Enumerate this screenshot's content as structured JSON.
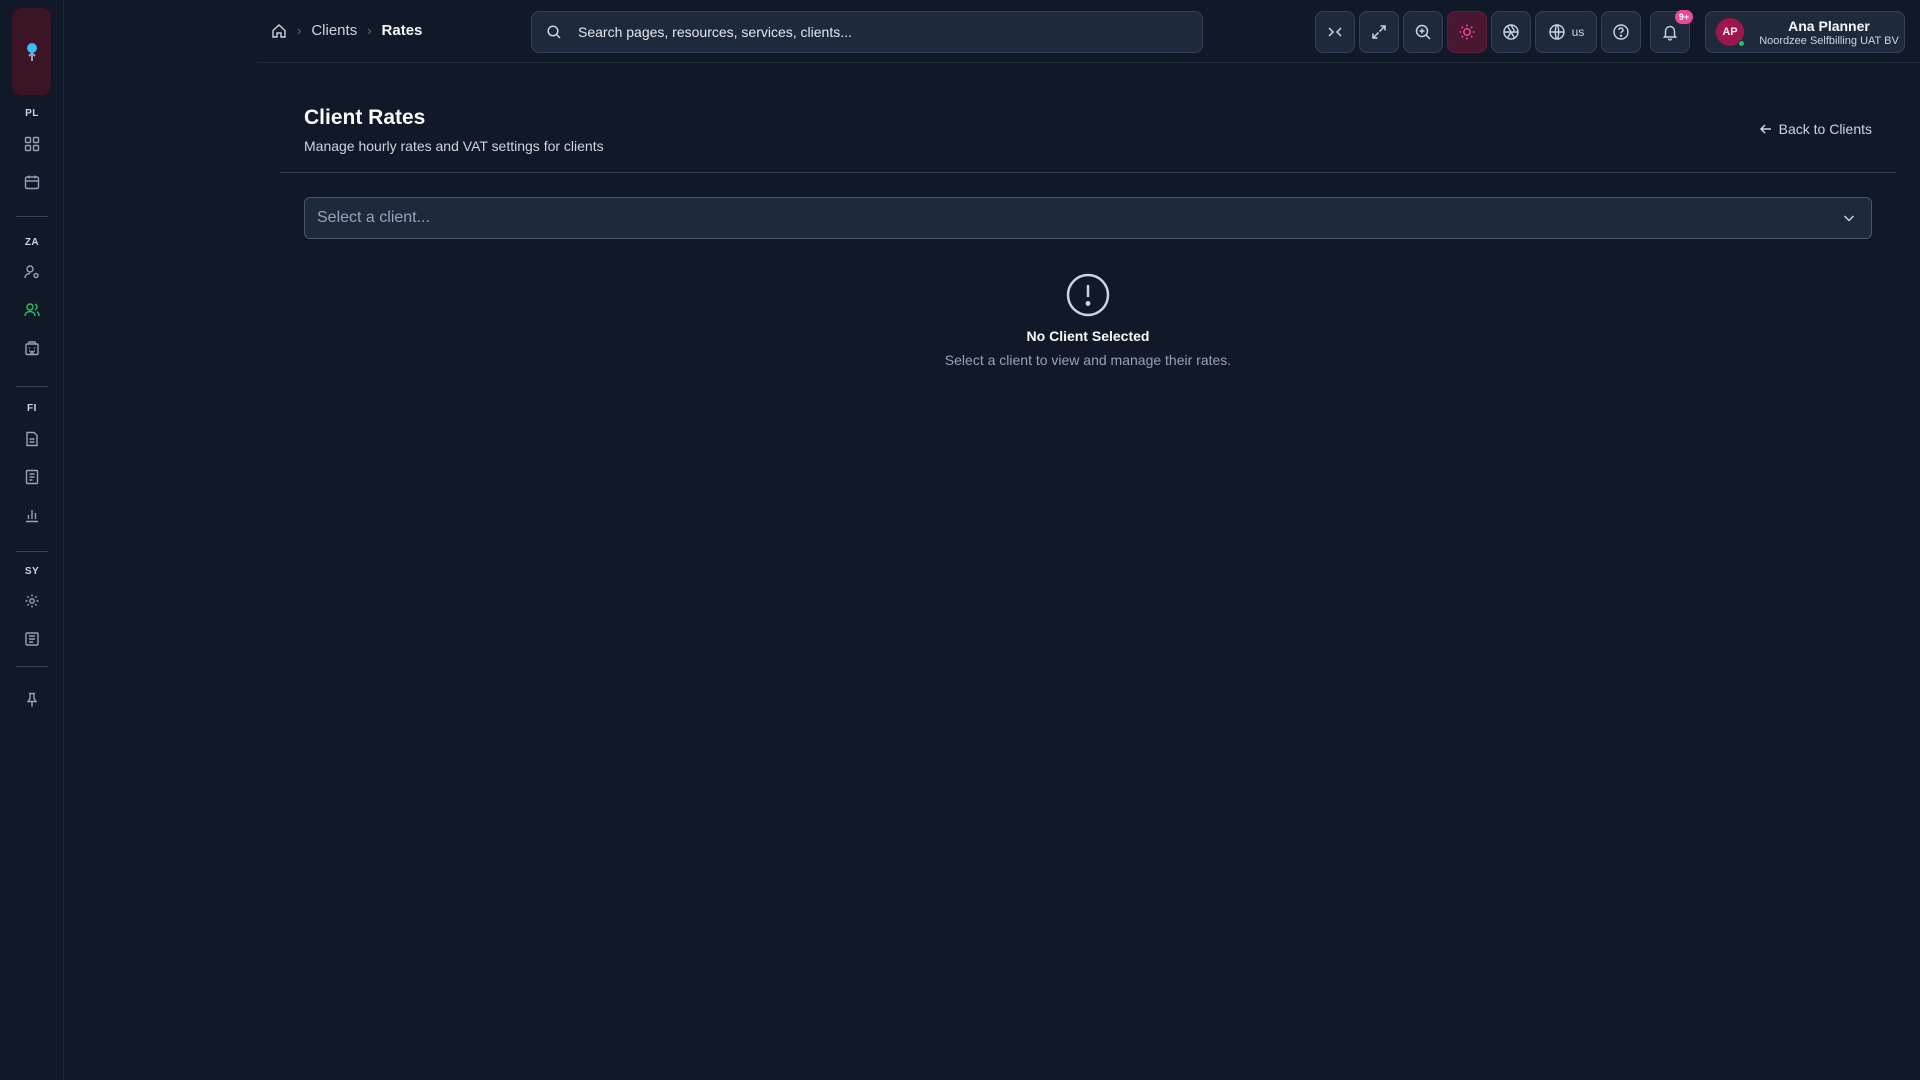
{
  "sidebar": {
    "sections": [
      {
        "label": "PL",
        "items": [
          "dashboard-icon",
          "calendar-icon"
        ]
      },
      {
        "label": "ZA",
        "items": [
          "user-cog-icon",
          "users-icon",
          "building-icon"
        ]
      },
      {
        "label": "FI",
        "items": [
          "file-text-icon",
          "receipt-icon",
          "bar-chart-icon"
        ]
      },
      {
        "label": "SY",
        "items": [
          "settings-icon",
          "logs-icon"
        ]
      }
    ],
    "active_item": "users-icon"
  },
  "breadcrumb": {
    "home_icon": "home-icon",
    "items": [
      "Clients",
      "Rates"
    ]
  },
  "search": {
    "placeholder": "Search pages, resources, services, clients..."
  },
  "toolbar": {
    "language": "us",
    "notification_count": "9+"
  },
  "user": {
    "initials": "AP",
    "name": "Ana Planner",
    "organization": "Noordzee Selfbilling UAT BV"
  },
  "page": {
    "title": "Client Rates",
    "subtitle": "Manage hourly rates and VAT settings for clients",
    "back_link": "Back to Clients"
  },
  "client_select": {
    "placeholder": "Select a client..."
  },
  "empty_state": {
    "title": "No Client Selected",
    "description": "Select a client to view and manage their rates."
  },
  "colors": {
    "background": "#111827",
    "accent": "#ec4899",
    "active_nav": "#22c55e"
  }
}
